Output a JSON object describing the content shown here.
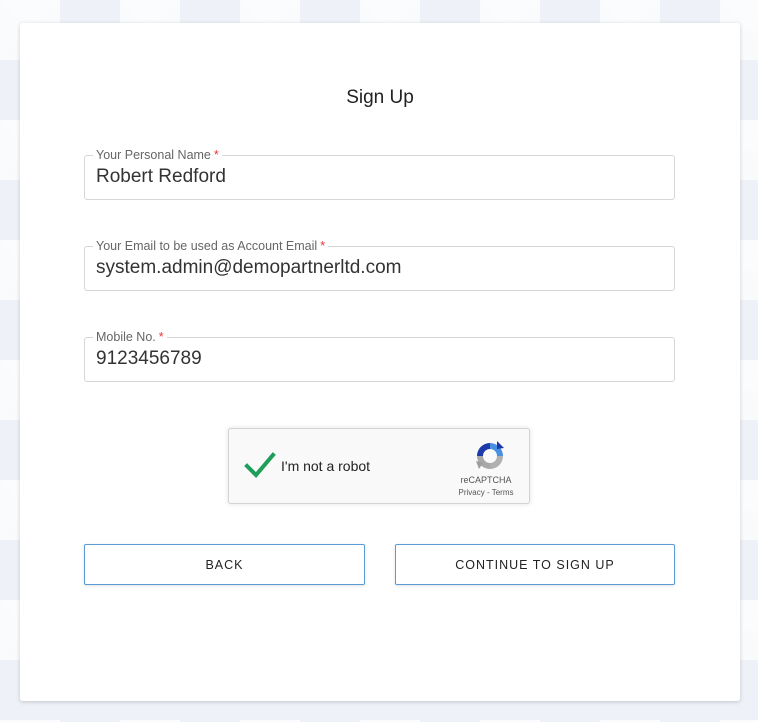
{
  "form": {
    "title": "Sign Up",
    "fields": [
      {
        "label": "Your Personal Name",
        "required_marker": "*",
        "value": "Robert Redford"
      },
      {
        "label": "Your Email to be used as Account Email",
        "required_marker": "*",
        "value": "system.admin@demopartnerltd.com"
      },
      {
        "label": "Mobile No.",
        "required_marker": "*",
        "value": "9123456789"
      }
    ]
  },
  "captcha": {
    "label": "I'm not a robot",
    "checked": true,
    "brand": "reCAPTCHA",
    "privacy": "Privacy",
    "separator": "-",
    "terms": "Terms",
    "check_icon": "checkmark-icon",
    "logo_icon": "recaptcha-logo-icon"
  },
  "buttons": {
    "back": "Back",
    "continue": "Continue to sign up"
  },
  "colors": {
    "accent_border": "#5b9bd5",
    "required": "#e53935",
    "check": "#1e9e5a"
  }
}
